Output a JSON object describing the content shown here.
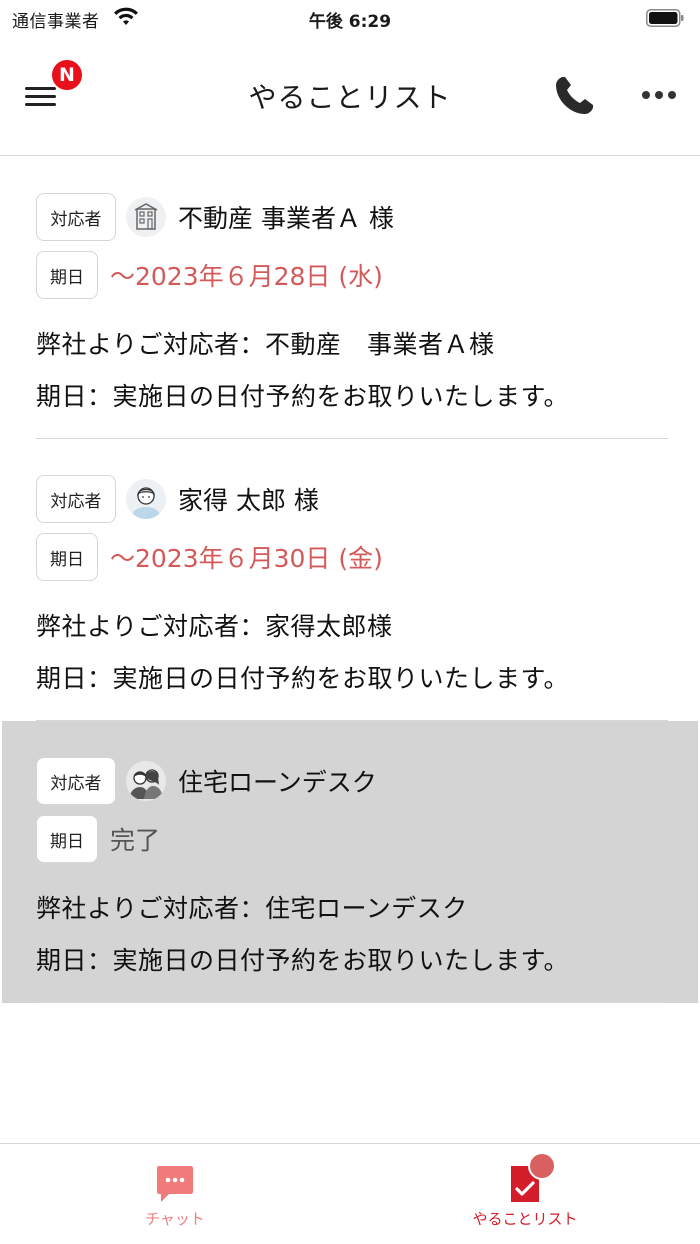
{
  "status_bar": {
    "carrier": "通信事業者",
    "time": "午後 6:29"
  },
  "nav": {
    "title": "やることリスト",
    "menu_badge": "N",
    "icons": [
      "hamburger-menu-icon",
      "phone-icon",
      "more-icon"
    ]
  },
  "labels": {
    "assignee_tag": "対応者",
    "due_tag": "期日"
  },
  "todos": [
    {
      "assignee": "不動産 事業者Ａ 様",
      "avatar_icon": "building-icon",
      "due": "～2023年６月28日 (水)",
      "status": "pending",
      "line1": "弊社よりご対応者：不動産　事業者Ａ様",
      "line2": "期日：実施日の日付予約をお取りいたします。"
    },
    {
      "assignee": "家得 太郎 様",
      "avatar_icon": "person-icon",
      "due": "～2023年６月30日 (金)",
      "status": "pending",
      "line1": "弊社よりご対応者：家得太郎様",
      "line2": "期日：実施日の日付予約をお取りいたします。"
    },
    {
      "assignee": "住宅ローンデスク",
      "avatar_icon": "couple-icon",
      "due": "完了",
      "status": "done",
      "line1": "弊社よりご対応者：住宅ローンデスク",
      "line2": "期日：実施日の日付予約をお取りいたします。"
    }
  ],
  "tabbar": {
    "tabs": [
      {
        "label": "チャット",
        "icon": "chat-bubble-icon",
        "active": false
      },
      {
        "label": "やることリスト",
        "icon": "checklist-icon",
        "active": true
      }
    ]
  },
  "colors": {
    "accent": "#d41e2a",
    "due_date": "#d45a5a",
    "badge": "#e8101b",
    "done_bg": "#d4d4d4"
  }
}
